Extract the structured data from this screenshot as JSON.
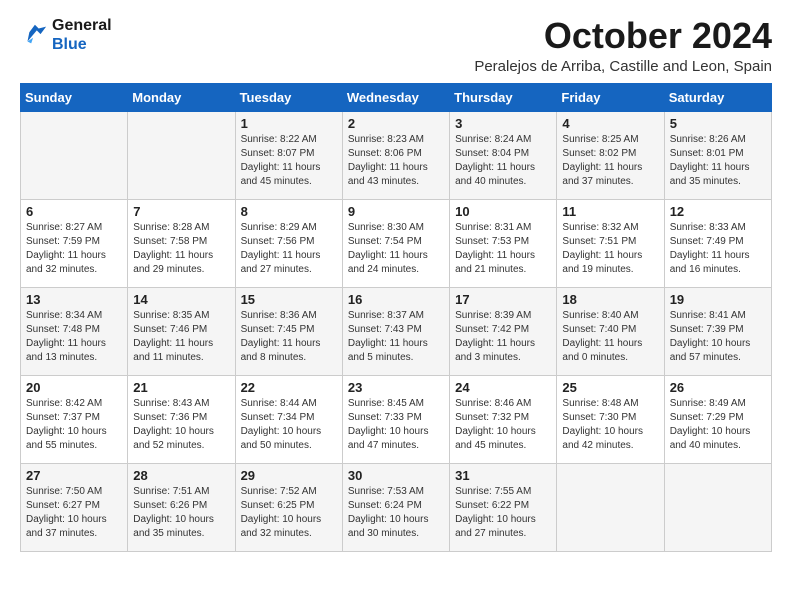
{
  "logo": {
    "line1": "General",
    "line2": "Blue"
  },
  "title": "October 2024",
  "subtitle": "Peralejos de Arriba, Castille and Leon, Spain",
  "weekdays": [
    "Sunday",
    "Monday",
    "Tuesday",
    "Wednesday",
    "Thursday",
    "Friday",
    "Saturday"
  ],
  "weeks": [
    [
      {
        "day": "",
        "info": ""
      },
      {
        "day": "",
        "info": ""
      },
      {
        "day": "1",
        "info": "Sunrise: 8:22 AM\nSunset: 8:07 PM\nDaylight: 11 hours and 45 minutes."
      },
      {
        "day": "2",
        "info": "Sunrise: 8:23 AM\nSunset: 8:06 PM\nDaylight: 11 hours and 43 minutes."
      },
      {
        "day": "3",
        "info": "Sunrise: 8:24 AM\nSunset: 8:04 PM\nDaylight: 11 hours and 40 minutes."
      },
      {
        "day": "4",
        "info": "Sunrise: 8:25 AM\nSunset: 8:02 PM\nDaylight: 11 hours and 37 minutes."
      },
      {
        "day": "5",
        "info": "Sunrise: 8:26 AM\nSunset: 8:01 PM\nDaylight: 11 hours and 35 minutes."
      }
    ],
    [
      {
        "day": "6",
        "info": "Sunrise: 8:27 AM\nSunset: 7:59 PM\nDaylight: 11 hours and 32 minutes."
      },
      {
        "day": "7",
        "info": "Sunrise: 8:28 AM\nSunset: 7:58 PM\nDaylight: 11 hours and 29 minutes."
      },
      {
        "day": "8",
        "info": "Sunrise: 8:29 AM\nSunset: 7:56 PM\nDaylight: 11 hours and 27 minutes."
      },
      {
        "day": "9",
        "info": "Sunrise: 8:30 AM\nSunset: 7:54 PM\nDaylight: 11 hours and 24 minutes."
      },
      {
        "day": "10",
        "info": "Sunrise: 8:31 AM\nSunset: 7:53 PM\nDaylight: 11 hours and 21 minutes."
      },
      {
        "day": "11",
        "info": "Sunrise: 8:32 AM\nSunset: 7:51 PM\nDaylight: 11 hours and 19 minutes."
      },
      {
        "day": "12",
        "info": "Sunrise: 8:33 AM\nSunset: 7:49 PM\nDaylight: 11 hours and 16 minutes."
      }
    ],
    [
      {
        "day": "13",
        "info": "Sunrise: 8:34 AM\nSunset: 7:48 PM\nDaylight: 11 hours and 13 minutes."
      },
      {
        "day": "14",
        "info": "Sunrise: 8:35 AM\nSunset: 7:46 PM\nDaylight: 11 hours and 11 minutes."
      },
      {
        "day": "15",
        "info": "Sunrise: 8:36 AM\nSunset: 7:45 PM\nDaylight: 11 hours and 8 minutes."
      },
      {
        "day": "16",
        "info": "Sunrise: 8:37 AM\nSunset: 7:43 PM\nDaylight: 11 hours and 5 minutes."
      },
      {
        "day": "17",
        "info": "Sunrise: 8:39 AM\nSunset: 7:42 PM\nDaylight: 11 hours and 3 minutes."
      },
      {
        "day": "18",
        "info": "Sunrise: 8:40 AM\nSunset: 7:40 PM\nDaylight: 11 hours and 0 minutes."
      },
      {
        "day": "19",
        "info": "Sunrise: 8:41 AM\nSunset: 7:39 PM\nDaylight: 10 hours and 57 minutes."
      }
    ],
    [
      {
        "day": "20",
        "info": "Sunrise: 8:42 AM\nSunset: 7:37 PM\nDaylight: 10 hours and 55 minutes."
      },
      {
        "day": "21",
        "info": "Sunrise: 8:43 AM\nSunset: 7:36 PM\nDaylight: 10 hours and 52 minutes."
      },
      {
        "day": "22",
        "info": "Sunrise: 8:44 AM\nSunset: 7:34 PM\nDaylight: 10 hours and 50 minutes."
      },
      {
        "day": "23",
        "info": "Sunrise: 8:45 AM\nSunset: 7:33 PM\nDaylight: 10 hours and 47 minutes."
      },
      {
        "day": "24",
        "info": "Sunrise: 8:46 AM\nSunset: 7:32 PM\nDaylight: 10 hours and 45 minutes."
      },
      {
        "day": "25",
        "info": "Sunrise: 8:48 AM\nSunset: 7:30 PM\nDaylight: 10 hours and 42 minutes."
      },
      {
        "day": "26",
        "info": "Sunrise: 8:49 AM\nSunset: 7:29 PM\nDaylight: 10 hours and 40 minutes."
      }
    ],
    [
      {
        "day": "27",
        "info": "Sunrise: 7:50 AM\nSunset: 6:27 PM\nDaylight: 10 hours and 37 minutes."
      },
      {
        "day": "28",
        "info": "Sunrise: 7:51 AM\nSunset: 6:26 PM\nDaylight: 10 hours and 35 minutes."
      },
      {
        "day": "29",
        "info": "Sunrise: 7:52 AM\nSunset: 6:25 PM\nDaylight: 10 hours and 32 minutes."
      },
      {
        "day": "30",
        "info": "Sunrise: 7:53 AM\nSunset: 6:24 PM\nDaylight: 10 hours and 30 minutes."
      },
      {
        "day": "31",
        "info": "Sunrise: 7:55 AM\nSunset: 6:22 PM\nDaylight: 10 hours and 27 minutes."
      },
      {
        "day": "",
        "info": ""
      },
      {
        "day": "",
        "info": ""
      }
    ]
  ]
}
